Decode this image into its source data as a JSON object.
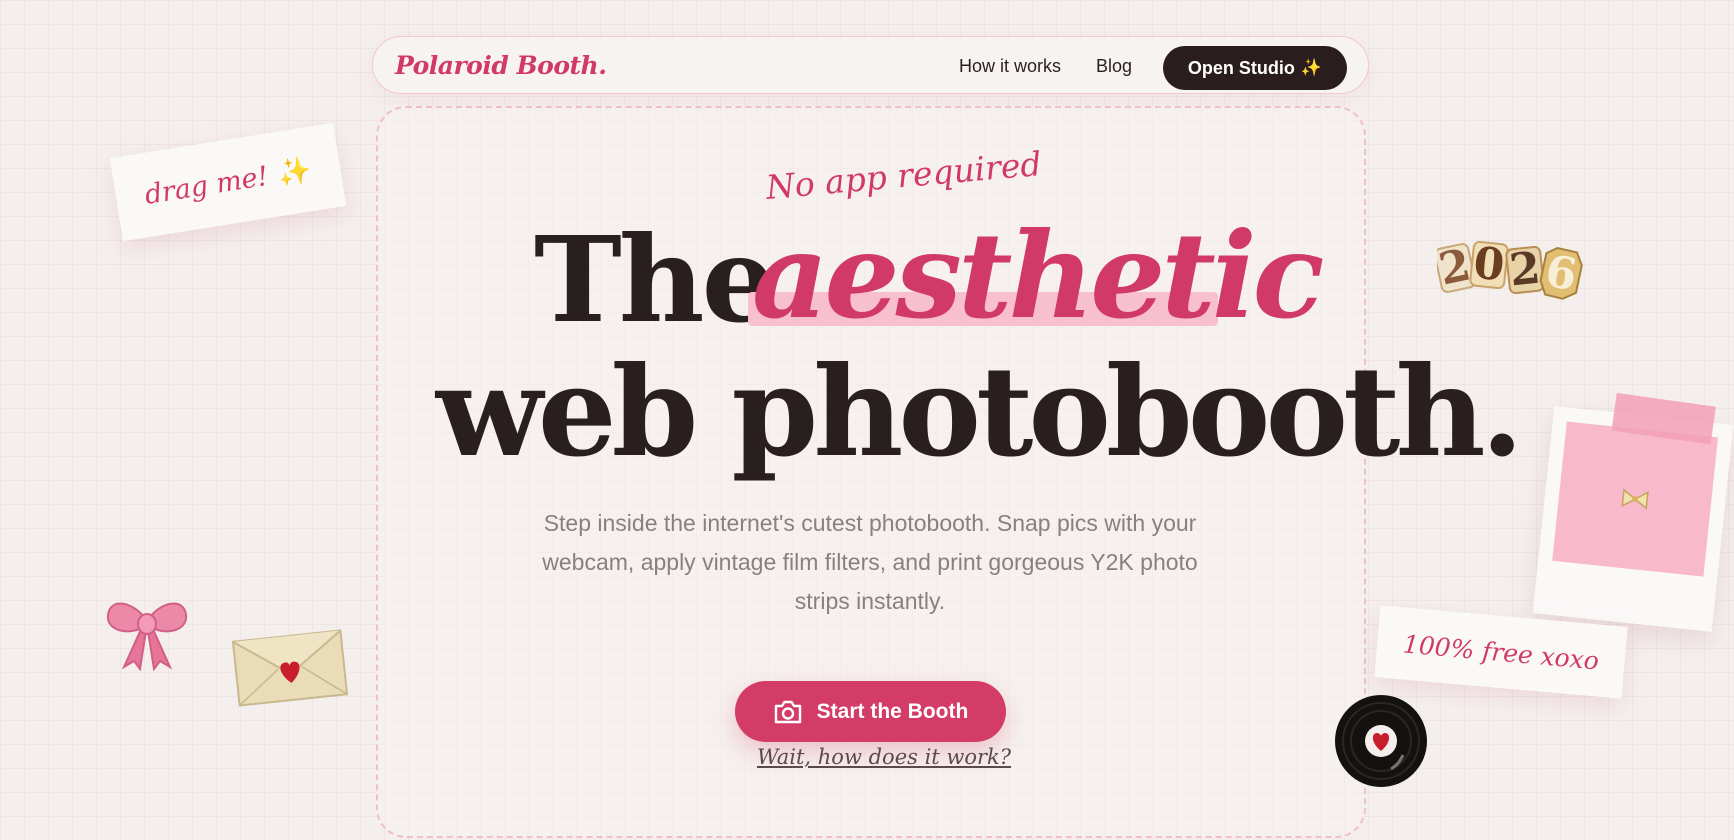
{
  "nav": {
    "brand": "Polaroid Booth.",
    "links": [
      "How it works",
      "Blog"
    ],
    "open_studio": "Open Studio",
    "open_studio_icon": "sparkles-icon"
  },
  "hero": {
    "tagline": "No app required",
    "headline_the": "The",
    "headline_accent": "aesthetic",
    "headline_line2": "web photobooth.",
    "subtitle": "Step inside the internet's cutest photobooth. Snap pics with your webcam, apply vintage film filters, and print gorgeous Y2K photo strips instantly.",
    "cta": "Start the Booth",
    "cta_icon": "camera-icon",
    "help_link": "Wait, how does it work?"
  },
  "stickers": {
    "drag_note": "drag me!",
    "drag_note_icon": "sparkles-icon",
    "free_note": "100% free xoxo",
    "year": "2026",
    "icons": [
      "bow-icon",
      "envelope-heart-icon",
      "vinyl-heart-icon",
      "polaroid-icon"
    ]
  },
  "colors": {
    "accent": "#d13a68",
    "dark": "#2a1d1d",
    "background": "#f4efed",
    "highlight": "#f7bfd0"
  }
}
